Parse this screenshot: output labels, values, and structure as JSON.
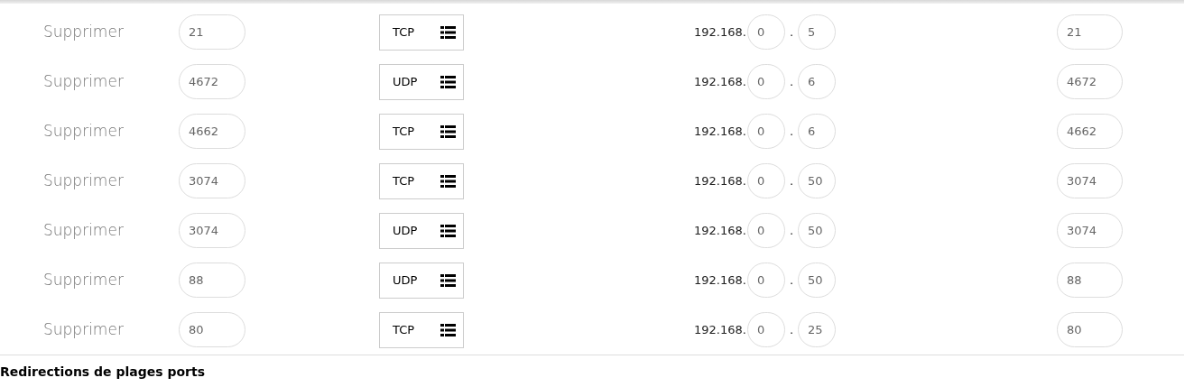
{
  "rows": [
    {
      "action": "Supprimer",
      "port": "21",
      "protocol": "TCP",
      "ip_prefix": "192.168.",
      "ip_3": "0",
      "ip_separator": ".",
      "ip_4": "5",
      "destination_port": "21"
    },
    {
      "action": "Supprimer",
      "port": "4672",
      "protocol": "UDP",
      "ip_prefix": "192.168.",
      "ip_3": "0",
      "ip_separator": ".",
      "ip_4": "6",
      "destination_port": "4672"
    },
    {
      "action": "Supprimer",
      "port": "4662",
      "protocol": "TCP",
      "ip_prefix": "192.168.",
      "ip_3": "0",
      "ip_separator": ".",
      "ip_4": "6",
      "destination_port": "4662"
    },
    {
      "action": "Supprimer",
      "port": "3074",
      "protocol": "TCP",
      "ip_prefix": "192.168.",
      "ip_3": "0",
      "ip_separator": ".",
      "ip_4": "50",
      "destination_port": "3074"
    },
    {
      "action": "Supprimer",
      "port": "3074",
      "protocol": "UDP",
      "ip_prefix": "192.168.",
      "ip_3": "0",
      "ip_separator": ".",
      "ip_4": "50",
      "destination_port": "3074"
    },
    {
      "action": "Supprimer",
      "port": "88",
      "protocol": "UDP",
      "ip_prefix": "192.168.",
      "ip_3": "0",
      "ip_separator": ".",
      "ip_4": "50",
      "destination_port": "88"
    },
    {
      "action": "Supprimer",
      "port": "80",
      "protocol": "TCP",
      "ip_prefix": "192.168.",
      "ip_3": "0",
      "ip_separator": ".",
      "ip_4": "25",
      "destination_port": "80"
    }
  ],
  "section_heading": "Redirections de plages ports"
}
